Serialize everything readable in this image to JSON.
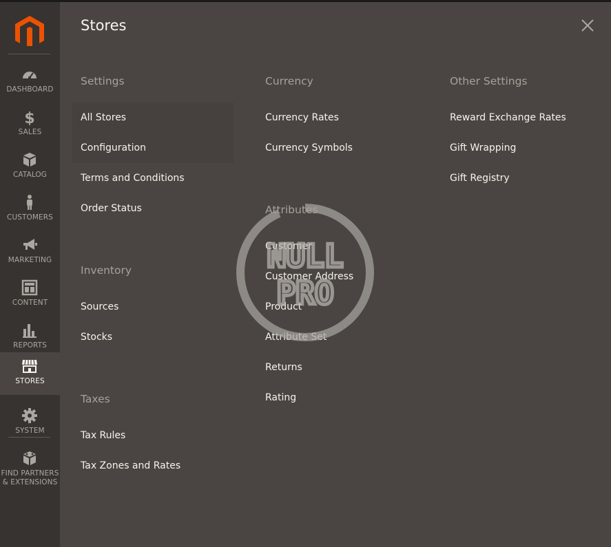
{
  "sidebar": {
    "logo_icon": "magento-logo-icon",
    "items": [
      {
        "label": "DASHBOARD",
        "icon": "speedometer-icon"
      },
      {
        "label": "SALES",
        "icon": "dollar-icon"
      },
      {
        "label": "CATALOG",
        "icon": "box-icon"
      },
      {
        "label": "CUSTOMERS",
        "icon": "person-icon"
      },
      {
        "label": "MARKETING",
        "icon": "megaphone-icon"
      },
      {
        "label": "CONTENT",
        "icon": "layout-icon"
      },
      {
        "label": "REPORTS",
        "icon": "bar-chart-icon"
      },
      {
        "label": "STORES",
        "icon": "storefront-icon",
        "active": true
      },
      {
        "label": "SYSTEM",
        "icon": "gear-icon"
      },
      {
        "label_line1": "FIND PARTNERS",
        "label_line2": "& EXTENSIONS",
        "icon": "blocks-icon"
      }
    ]
  },
  "panel": {
    "title": "Stores",
    "close_icon": "close-icon",
    "settings": {
      "heading": "Settings",
      "links": [
        "All Stores",
        "Configuration",
        "Terms and Conditions",
        "Order Status"
      ]
    },
    "inventory": {
      "heading": "Inventory",
      "links": [
        "Sources",
        "Stocks"
      ]
    },
    "taxes": {
      "heading": "Taxes",
      "links": [
        "Tax Rules",
        "Tax Zones and Rates"
      ]
    },
    "currency": {
      "heading": "Currency",
      "links": [
        "Currency Rates",
        "Currency Symbols"
      ]
    },
    "attributes": {
      "heading": "Attributes",
      "links": [
        "Customer",
        "Customer Address",
        "Product",
        "Attribute Set",
        "Returns",
        "Rating"
      ]
    },
    "other_settings": {
      "heading": "Other Settings",
      "links": [
        "Reward Exchange Rates",
        "Gift Wrapping",
        "Gift Registry"
      ]
    }
  },
  "watermark": {
    "line1": "NULL",
    "line2": "PRO"
  },
  "colors": {
    "sidebar_bg": "#373330",
    "panel_bg": "#4a4542",
    "accent": "#eb5202",
    "heading": "#a6a19a",
    "text": "#f7f3eb"
  }
}
